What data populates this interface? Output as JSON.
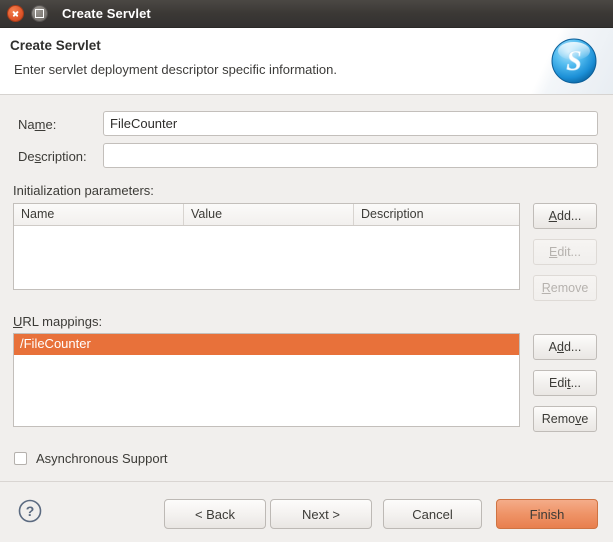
{
  "window": {
    "title": "Create Servlet",
    "close_icon": "window-close-icon",
    "maximize_icon": "window-maximize-icon"
  },
  "header": {
    "title": "Create Servlet",
    "description": "Enter servlet deployment descriptor specific information.",
    "banner_icon": "servlet-s-icon"
  },
  "form": {
    "name": {
      "label_pre": "Na",
      "label_mn": "m",
      "label_post": "e:",
      "value": "FileCounter",
      "placeholder": ""
    },
    "description": {
      "label_pre": "De",
      "label_mn": "s",
      "label_post": "cription:",
      "value": "",
      "placeholder": ""
    }
  },
  "init_params": {
    "label": "Initialization parameters:",
    "columns": [
      "Name",
      "Value",
      "Description"
    ],
    "rows": [],
    "buttons": [
      {
        "pre": "",
        "mn": "A",
        "post": "dd...",
        "enabled": true,
        "name": "init-params-add-button"
      },
      {
        "pre": "",
        "mn": "E",
        "post": "dit...",
        "enabled": false,
        "name": "init-params-edit-button"
      },
      {
        "pre": "",
        "mn": "R",
        "post": "emove",
        "enabled": false,
        "name": "init-params-remove-button"
      }
    ]
  },
  "url_mappings": {
    "label_pre": "",
    "label_mn": "U",
    "label_post": "RL mappings:",
    "rows": [
      {
        "text": "/FileCounter",
        "selected": true
      }
    ],
    "buttons": [
      {
        "pre": "A",
        "mn": "d",
        "post": "d...",
        "enabled": true,
        "name": "url-mappings-add-button"
      },
      {
        "pre": "Edi",
        "mn": "t",
        "post": "...",
        "enabled": true,
        "name": "url-mappings-edit-button"
      },
      {
        "pre": "Remo",
        "mn": "v",
        "post": "e",
        "enabled": true,
        "name": "url-mappings-remove-button"
      }
    ]
  },
  "async": {
    "label": "Asynchronous Support",
    "checked": false
  },
  "footer": {
    "help_icon": "help-question-icon",
    "back_label": "< Back",
    "next_label": "Next >",
    "cancel_label": "Cancel",
    "finish_label": "Finish"
  },
  "colors": {
    "selection_orange": "#e8713a",
    "primary_button": "#ef9468",
    "titlebar": "#3b3835",
    "body_bg": "#f1efed"
  }
}
